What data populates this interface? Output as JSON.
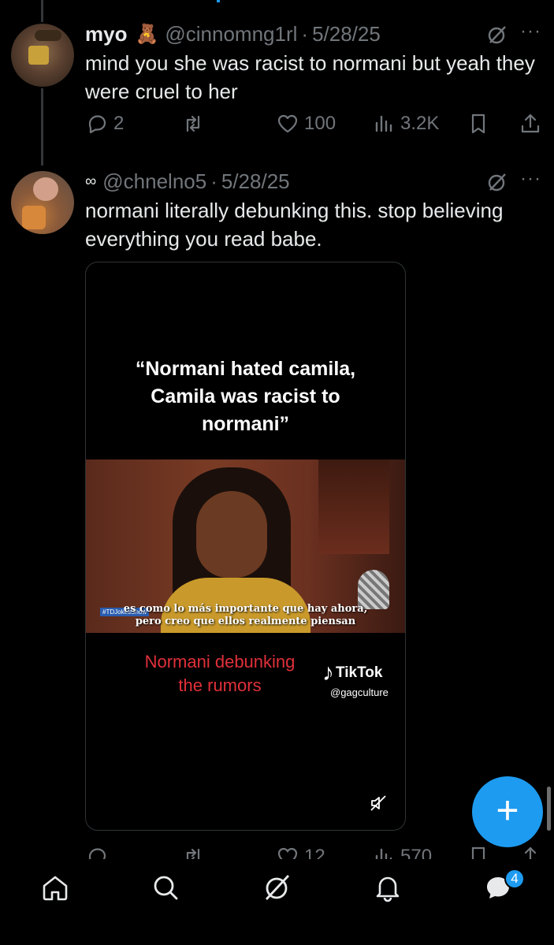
{
  "tweets": [
    {
      "name": "myo",
      "emoji": "🧸",
      "handle": "@cinnomng1rl",
      "separator": "·",
      "date": "5/28/25",
      "more": "···",
      "text": "mind you she was racist to normani but yeah they were cruel to her",
      "replies": "2",
      "retweets": "",
      "likes": "100",
      "views": "3.2K"
    },
    {
      "name": "",
      "name_icon": "infinity-icon",
      "handle": "@chnelno5",
      "separator": "·",
      "date": "5/28/25",
      "more": "···",
      "text": "normani literally debunking this. stop believing everything you read babe.",
      "replies": "",
      "retweets": "",
      "likes": "12",
      "views": "570"
    }
  ],
  "video": {
    "quote": "“Normani hated camila, Camila was racist to normani”",
    "subtitle_line1": "es como lo más importante que hay ahora,",
    "subtitle_line2": "pero creo que ellos realmente piensan",
    "show_tag": "#TDJokesShow",
    "caption": "Normani debunking the rumors",
    "tiktok_label": "TikTok",
    "tiktok_handle": "@gagculture"
  },
  "nav": {
    "items": [
      "home-icon",
      "search-icon",
      "grok-icon",
      "bell-icon",
      "messages-icon"
    ],
    "messages_badge": "4"
  },
  "fab": {
    "label": "+"
  },
  "colors": {
    "accent": "#1d9bf0",
    "muted": "#71767b",
    "caption_red": "#e0303a"
  }
}
